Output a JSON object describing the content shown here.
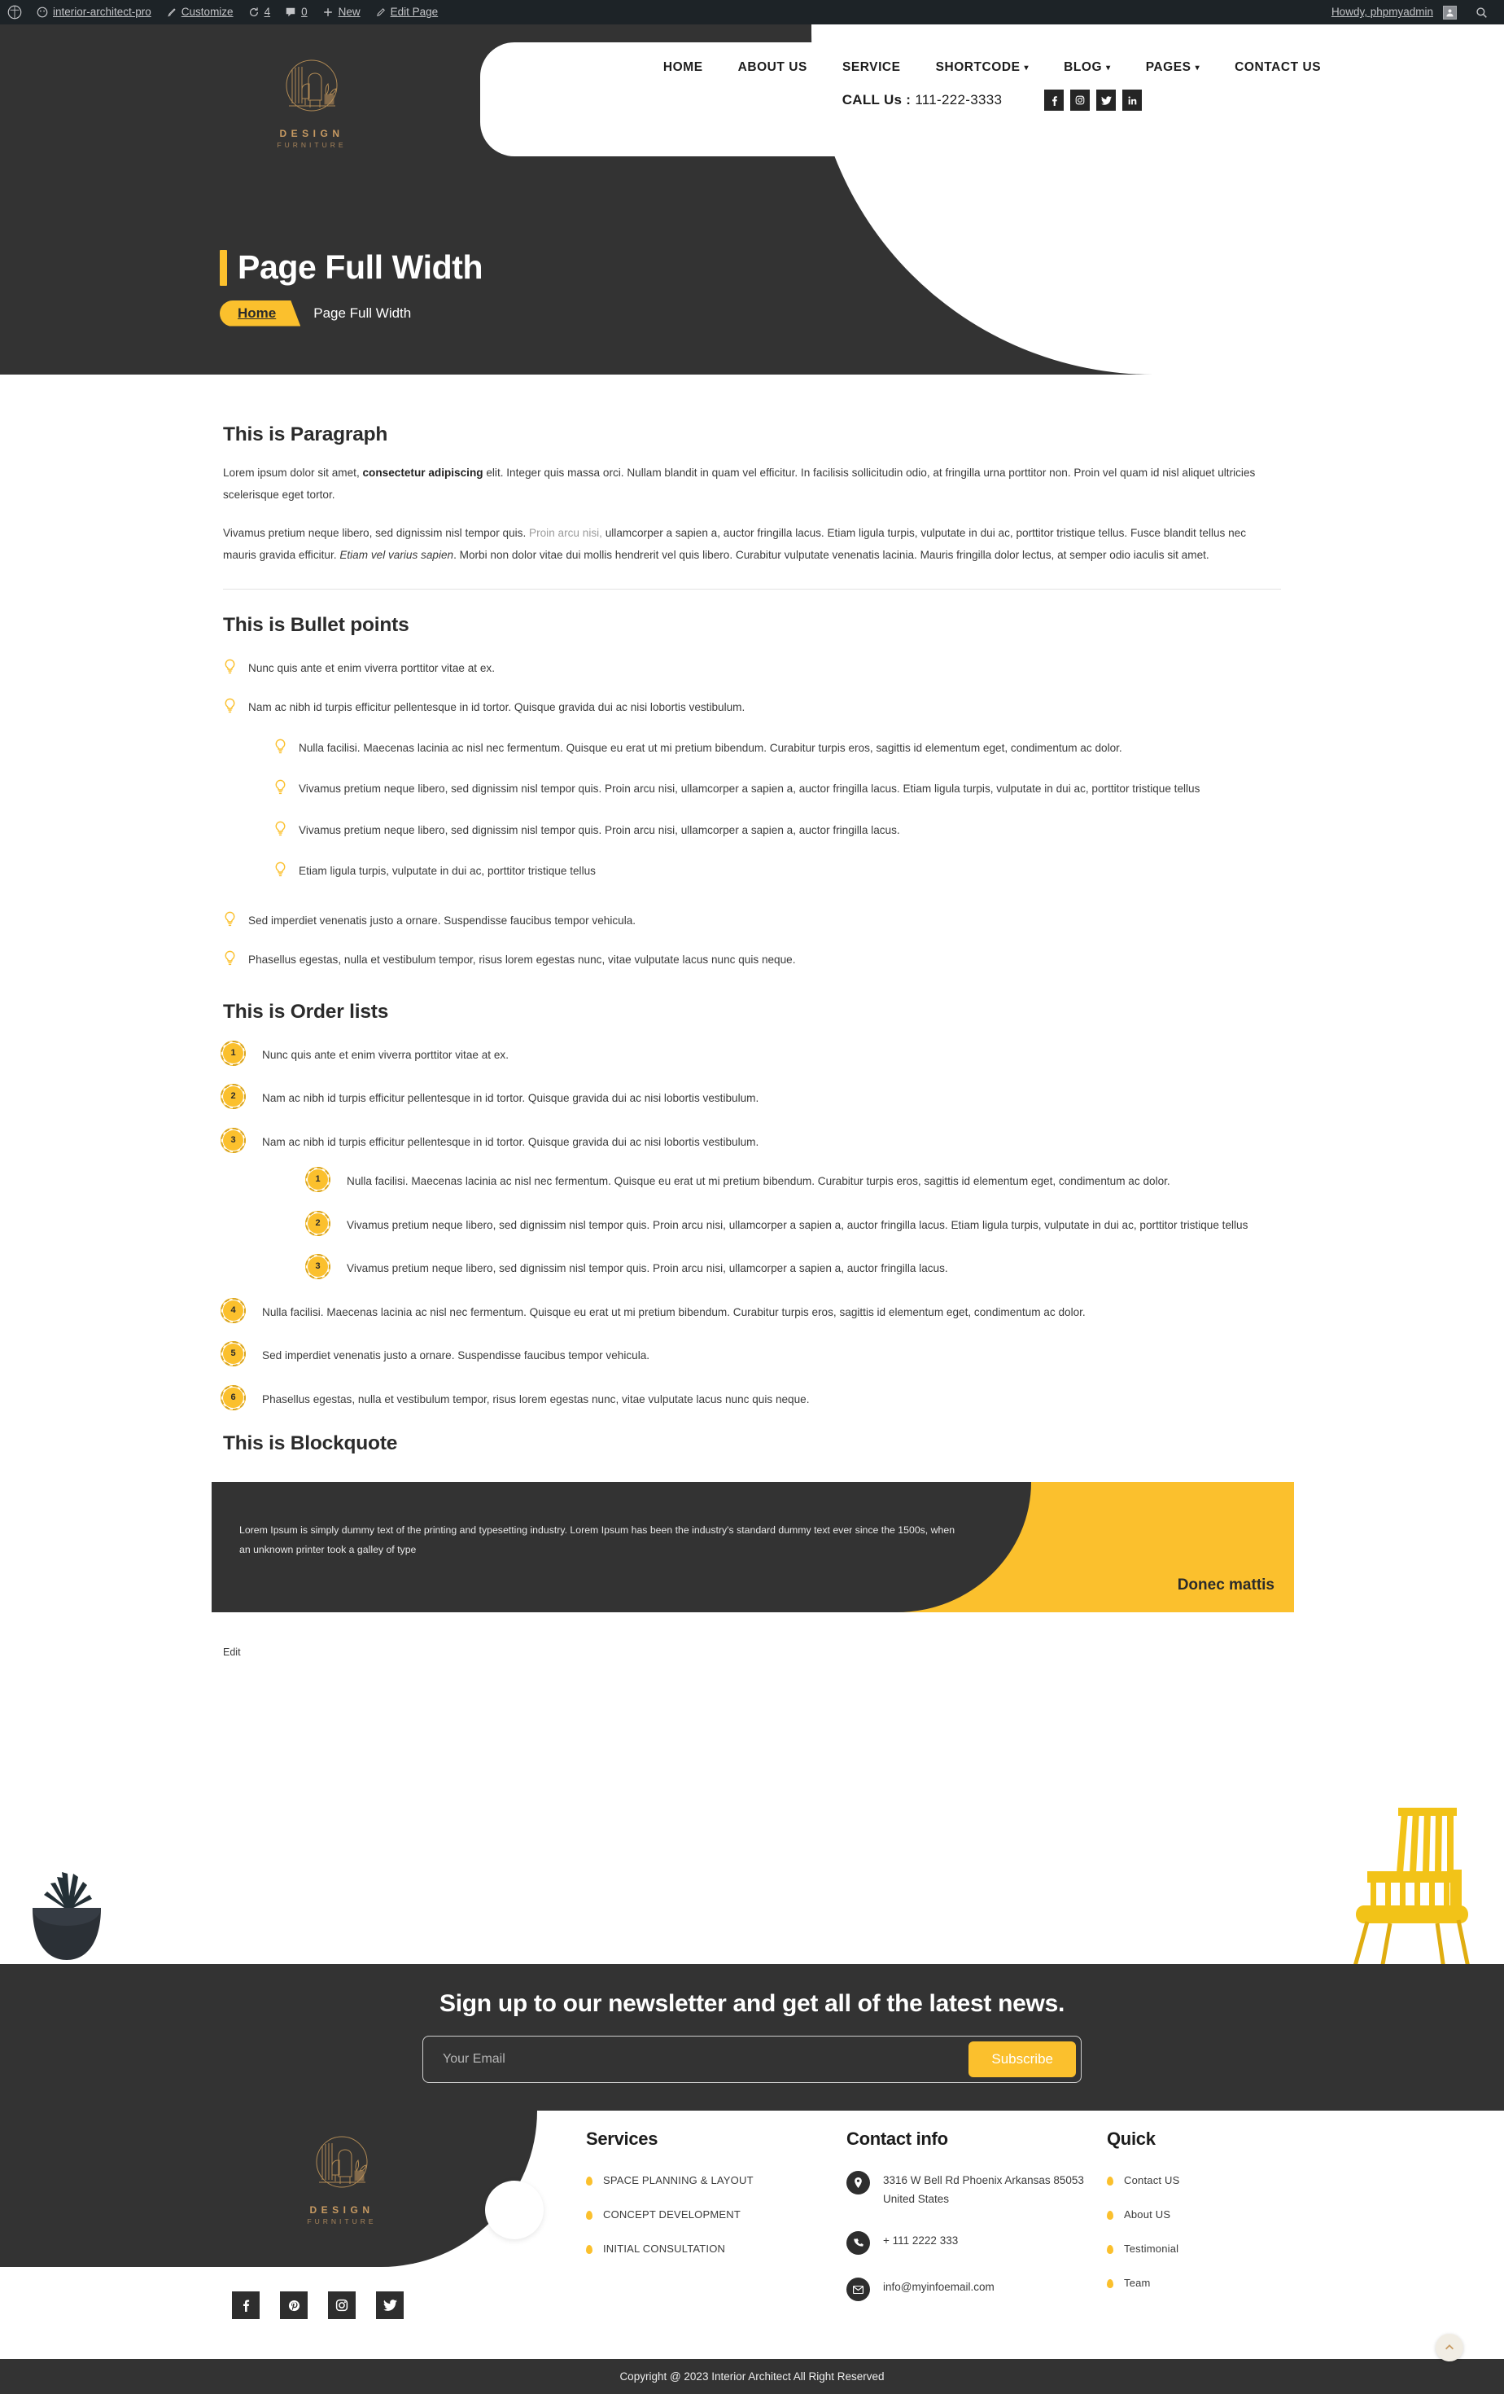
{
  "adminbar": {
    "site_name": "interior-architect-pro",
    "customize": "Customize",
    "updates_count": "4",
    "comments_count": "0",
    "new": "New",
    "edit_page": "Edit Page",
    "howdy": "Howdy, phpmyadmin"
  },
  "brand": {
    "name": "DESIGN",
    "sub": "FURNITURE",
    "gold": "#c79a62"
  },
  "nav": {
    "items": [
      {
        "label": "HOME",
        "caret": false
      },
      {
        "label": "ABOUT US",
        "caret": false
      },
      {
        "label": "SERVICE",
        "caret": false
      },
      {
        "label": "SHORTCODE",
        "caret": true
      },
      {
        "label": "BLOG",
        "caret": true
      },
      {
        "label": "PAGES",
        "caret": true
      },
      {
        "label": "CONTACT US",
        "caret": false
      }
    ],
    "call_label": "CALL Us :",
    "call_number": "111-222-3333",
    "socials": [
      "facebook-icon",
      "instagram-icon",
      "twitter-icon",
      "linkedin-icon"
    ]
  },
  "page_header": {
    "title": "Page Full Width",
    "breadcrumb_home": "Home",
    "breadcrumb_current": "Page Full Width"
  },
  "sections": {
    "paragraph": {
      "heading": "This is Paragraph",
      "p1_a": "Lorem ipsum dolor sit amet, ",
      "p1_b": "consectetur adipiscing",
      "p1_c": " elit. Integer quis massa orci. Nullam blandit in quam vel efficitur. In facilisis sollicitudin odio, at fringilla urna porttitor non. Proin vel quam id nisl aliquet ultricies scelerisque eget tortor.",
      "p2_a": "Vivamus pretium neque libero, sed dignissim nisl tempor quis. ",
      "p2_link": "Proin arcu nisi,",
      "p2_b": " ullamcorper a sapien a, auctor fringilla lacus. Etiam ligula turpis, vulputate in dui ac, porttitor tristique tellus. Fusce blandit tellus nec mauris gravida efficitur. ",
      "p2_em": "Etiam vel varius sapien",
      "p2_c": ". Morbi non dolor vitae dui mollis hendrerit vel quis libero. Curabitur vulputate venenatis lacinia. Mauris fringilla dolor lectus, at semper odio iaculis sit amet."
    },
    "bullets": {
      "heading": "This is Bullet points",
      "items": [
        "Nunc quis ante et enim viverra porttitor vitae at ex.",
        "Nam ac nibh id turpis efficitur pellentesque in id tortor. Quisque gravida dui ac nisi lobortis vestibulum.",
        "Sed imperdiet venenatis justo a ornare. Suspendisse faucibus tempor vehicula.",
        "Phasellus egestas, nulla et vestibulum tempor, risus lorem egestas nunc, vitae vulputate lacus nunc quis neque."
      ],
      "nested": [
        "Nulla facilisi. Maecenas lacinia ac nisl nec fermentum. Quisque eu erat ut mi pretium bibendum. Curabitur turpis eros, sagittis id elementum eget, condimentum ac dolor.",
        "Vivamus pretium neque libero, sed dignissim nisl tempor quis. Proin arcu nisi, ullamcorper a sapien a, auctor fringilla lacus. Etiam ligula turpis, vulputate in dui ac, porttitor tristique tellus",
        "Vivamus pretium neque libero, sed dignissim nisl tempor quis. Proin arcu nisi, ullamcorper a sapien a, auctor fringilla lacus.",
        "Etiam ligula turpis, vulputate in dui ac, porttitor tristique tellus"
      ]
    },
    "orderlist": {
      "heading": "This is Order lists",
      "items": [
        {
          "n": "1",
          "text": "Nunc quis ante et enim viverra porttitor vitae at ex."
        },
        {
          "n": "2",
          "text": "Nam ac nibh id turpis efficitur pellentesque in id tortor. Quisque gravida dui ac nisi lobortis vestibulum."
        },
        {
          "n": "3",
          "text": "Nam ac nibh id turpis efficitur pellentesque in id tortor. Quisque gravida dui ac nisi lobortis vestibulum."
        },
        {
          "n": "4",
          "text": "Nulla facilisi. Maecenas lacinia ac nisl nec fermentum. Quisque eu erat ut mi pretium bibendum. Curabitur turpis eros, sagittis id elementum eget, condimentum ac dolor."
        },
        {
          "n": "5",
          "text": "Sed imperdiet venenatis justo a ornare. Suspendisse faucibus tempor vehicula."
        },
        {
          "n": "6",
          "text": "Phasellus egestas, nulla et vestibulum tempor, risus lorem egestas nunc, vitae vulputate lacus nunc quis neque."
        }
      ],
      "nested": [
        {
          "n": "1",
          "text": "Nulla facilisi. Maecenas lacinia ac nisl nec fermentum. Quisque eu erat ut mi pretium bibendum. Curabitur turpis eros, sagittis id elementum eget, condimentum ac dolor."
        },
        {
          "n": "2",
          "text": "Vivamus pretium neque libero, sed dignissim nisl tempor quis. Proin arcu nisi, ullamcorper a sapien a, auctor fringilla lacus. Etiam ligula turpis, vulputate in dui ac, porttitor tristique tellus"
        },
        {
          "n": "3",
          "text": "Vivamus pretium neque libero, sed dignissim nisl tempor quis. Proin arcu nisi, ullamcorper a sapien a, auctor fringilla lacus."
        }
      ]
    },
    "blockquote": {
      "heading": "This is Blockquote",
      "text": "Lorem Ipsum is simply dummy text of the printing and typesetting industry. Lorem Ipsum has been the industry's standard dummy text ever since the 1500s, when an unknown printer took a galley of type",
      "author": "Donec mattis"
    },
    "edit_link": "Edit"
  },
  "newsletter": {
    "heading": "Sign up to our newsletter and get all of the latest news.",
    "placeholder": "Your Email",
    "value": "",
    "button": "Subscribe"
  },
  "footer": {
    "socials": [
      "facebook-icon",
      "pinterest-icon",
      "instagram-icon",
      "twitter-icon"
    ],
    "services": {
      "title": "Services",
      "items": [
        "SPACE PLANNING & LAYOUT",
        "CONCEPT DEVELOPMENT",
        "INITIAL CONSULTATION"
      ]
    },
    "contact": {
      "title": "Contact info",
      "address": "3316 W Bell Rd Phoenix Arkansas 85053 United States",
      "phone": "+ 111 2222 333",
      "email": "info@myinfoemail.com"
    },
    "quick": {
      "title": "Quick",
      "items": [
        "Contact US",
        "About US",
        "Testimonial",
        "Team"
      ]
    },
    "copyright": "Copyright @ 2023 Interior Architect All Right Reserved"
  },
  "colors": {
    "accent": "#fbc02d",
    "dark": "#333333",
    "gold": "#c79a62"
  }
}
